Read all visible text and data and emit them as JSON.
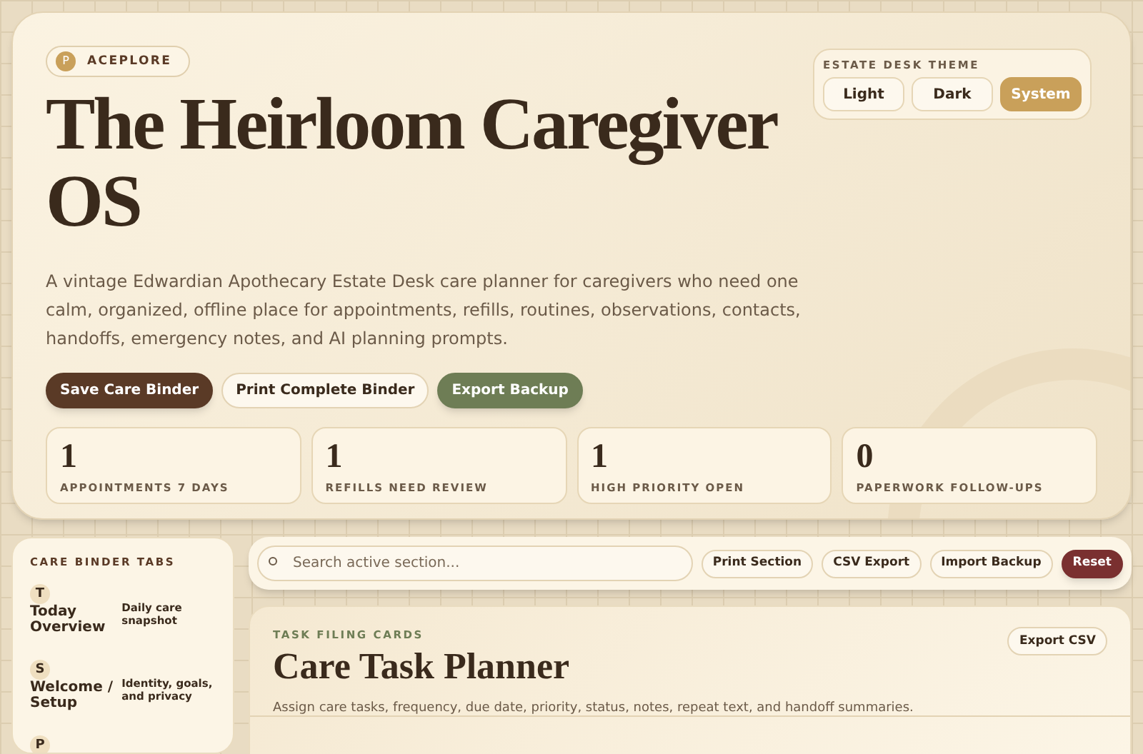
{
  "brand": {
    "initial": "P",
    "name": "ACEPLORE"
  },
  "theme": {
    "label": "ESTATE DESK THEME",
    "options": [
      {
        "label": "Light",
        "selected": false
      },
      {
        "label": "Dark",
        "selected": false
      },
      {
        "label": "System",
        "selected": true
      }
    ]
  },
  "title": "The Heirloom Caregiver OS",
  "description": "A vintage Edwardian Apothecary Estate Desk care planner for caregivers who need one calm, organized, offline place for appointments, refills, routines, observations, contacts, handoffs, emergency notes, and AI planning prompts.",
  "actions": [
    {
      "label": "Save Care Binder",
      "kind": "primary"
    },
    {
      "label": "Print Complete Binder",
      "kind": "plain"
    },
    {
      "label": "Export Backup",
      "kind": "green"
    }
  ],
  "stats": [
    {
      "value": "1",
      "label": "APPOINTMENTS 7 DAYS"
    },
    {
      "value": "1",
      "label": "REFILLS NEED REVIEW"
    },
    {
      "value": "1",
      "label": "HIGH PRIORITY OPEN"
    },
    {
      "value": "0",
      "label": "PAPERWORK FOLLOW-UPS"
    }
  ],
  "sidebar": {
    "heading": "CARE BINDER TABS",
    "items": [
      {
        "initial": "T",
        "label": "Today Overview",
        "note": "Daily care snapshot"
      },
      {
        "initial": "S",
        "label": "Welcome / Setup",
        "note": "Identity, goals, and privacy"
      },
      {
        "initial": "P"
      }
    ]
  },
  "toolbar": {
    "search_placeholder": "Search active section...",
    "buttons": [
      {
        "label": "Print Section",
        "kind": "plain"
      },
      {
        "label": "CSV Export",
        "kind": "plain"
      },
      {
        "label": "Import Backup",
        "kind": "plain"
      },
      {
        "label": "Reset",
        "kind": "danger"
      }
    ]
  },
  "section": {
    "eyebrow": "TASK FILING CARDS",
    "title": "Care Task Planner",
    "description": "Assign care tasks, frequency, due date, priority, status, notes, repeat text, and handoff summaries.",
    "button": "Export CSV"
  }
}
